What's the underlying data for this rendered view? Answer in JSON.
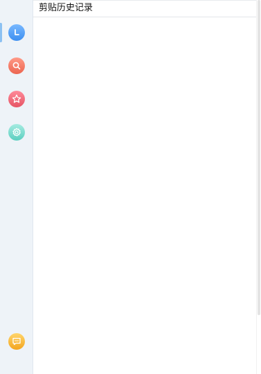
{
  "header": {
    "title": "剪贴历史记录"
  },
  "sidebar": {
    "items": [
      {
        "id": "history",
        "icon": "clock-icon",
        "color": "#4a97f4",
        "active": true
      },
      {
        "id": "search",
        "icon": "search-icon",
        "color": "#ef6f5b"
      },
      {
        "id": "favorites",
        "icon": "star-icon",
        "color": "#ea5d6d"
      },
      {
        "id": "settings",
        "icon": "gear-icon",
        "color": "#6dd5c7"
      }
    ],
    "bottom_item": {
      "id": "feedback",
      "icon": "chat-bubble-icon",
      "color": "#f5ae2b"
    }
  },
  "list": {
    "items": []
  }
}
